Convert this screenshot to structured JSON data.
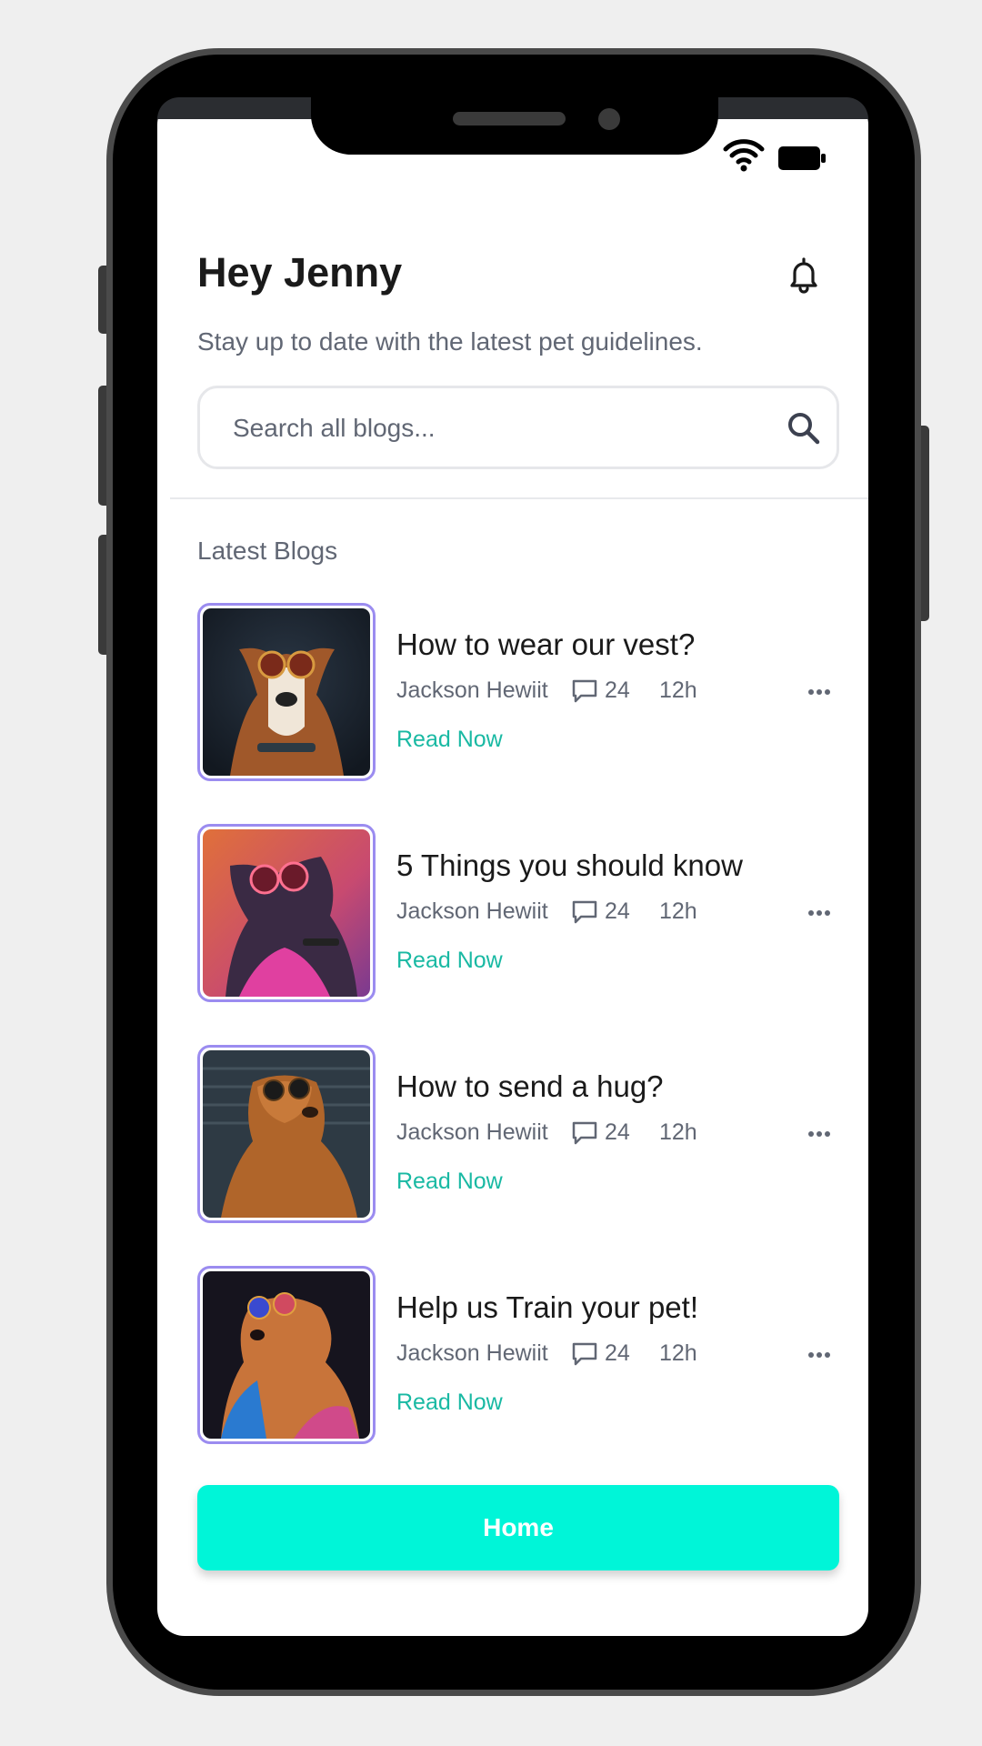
{
  "header": {
    "greeting": "Hey Jenny",
    "subtitle": "Stay up to date with the latest pet guidelines."
  },
  "search": {
    "placeholder": "Search all blogs..."
  },
  "section": {
    "title": "Latest Blogs"
  },
  "blogs": [
    {
      "title": "How to wear our vest?",
      "author": "Jackson Hewiit",
      "comments": "24",
      "time": "12h",
      "cta": "Read Now"
    },
    {
      "title": "5 Things you should know",
      "author": "Jackson Hewiit",
      "comments": "24",
      "time": "12h",
      "cta": "Read Now"
    },
    {
      "title": "How to send a hug?",
      "author": "Jackson Hewiit",
      "comments": "24",
      "time": "12h",
      "cta": "Read Now"
    },
    {
      "title": "Help us Train your pet!",
      "author": "Jackson Hewiit",
      "comments": "24",
      "time": "12h",
      "cta": "Read Now"
    }
  ],
  "footer": {
    "home_label": "Home"
  },
  "colors": {
    "accent": "#00f5d8",
    "link": "#19b9a3",
    "thumb_border": "#9b8cf0",
    "muted_text": "#616774"
  },
  "icons": [
    "wifi-icon",
    "battery-icon",
    "bell-icon",
    "search-icon",
    "comment-icon",
    "more-icon"
  ]
}
